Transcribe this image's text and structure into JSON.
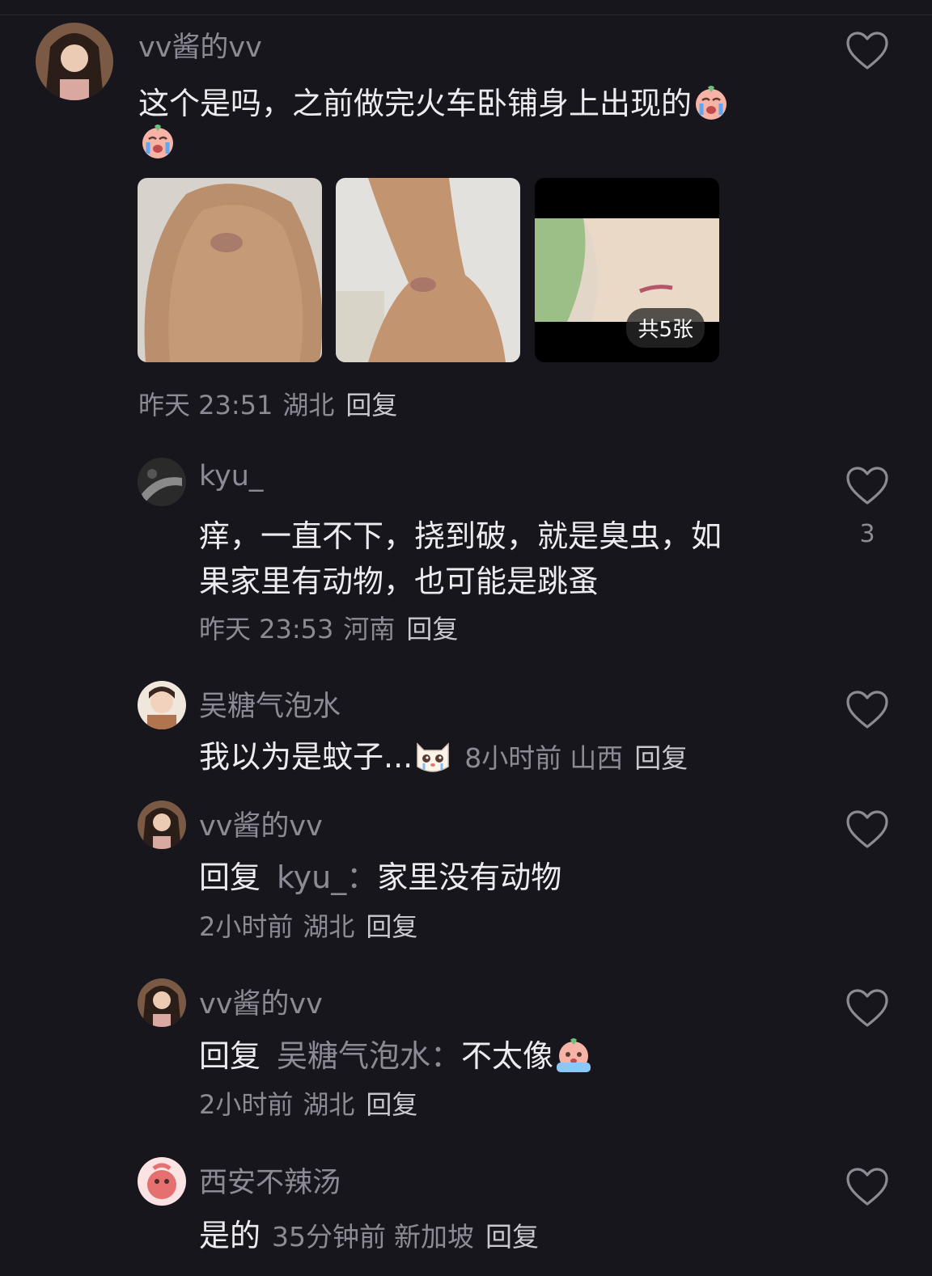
{
  "comments": [
    {
      "username": "vv酱的vv",
      "text": "这个是吗，之前做完火车卧铺身上出现的",
      "time": "昨天 23:51",
      "location": "湖北",
      "reply_label": "回复",
      "photo_count_badge": "共5张",
      "emoji": "crying-emoji"
    },
    {
      "username": "kyu_",
      "text_line1": "痒，一直不下，挠到破，就是臭虫，如",
      "text_line2": "果家里有动物，也可能是跳蚤",
      "time": "昨天 23:53",
      "location": "河南",
      "reply_label": "回复",
      "likes": "3"
    },
    {
      "username": "吴糖气泡水",
      "text": "我以为是蚊子...",
      "time": "8小时前",
      "location": "山西",
      "reply_label": "回复",
      "emoji": "crying-cat-emoji"
    },
    {
      "username": "vv酱的vv",
      "reply_prefix": "回复",
      "reply_to": "kyu_：",
      "text": "家里没有动物",
      "time": "2小时前",
      "location": "湖北",
      "reply_label": "回复"
    },
    {
      "username": "vv酱的vv",
      "reply_prefix": "回复",
      "reply_to": "吴糖气泡水：",
      "text": "不太像",
      "time": "2小时前",
      "location": "湖北",
      "reply_label": "回复",
      "emoji": "scared-emoji"
    },
    {
      "username": "西安不辣汤",
      "text": "是的",
      "time": "35分钟前",
      "location": "新加坡",
      "reply_label": "回复"
    }
  ],
  "icons": {
    "like": "heart-outline-icon"
  },
  "colors": {
    "background": "#17161d",
    "text": "#ececf0",
    "muted": "#8c8b95"
  }
}
